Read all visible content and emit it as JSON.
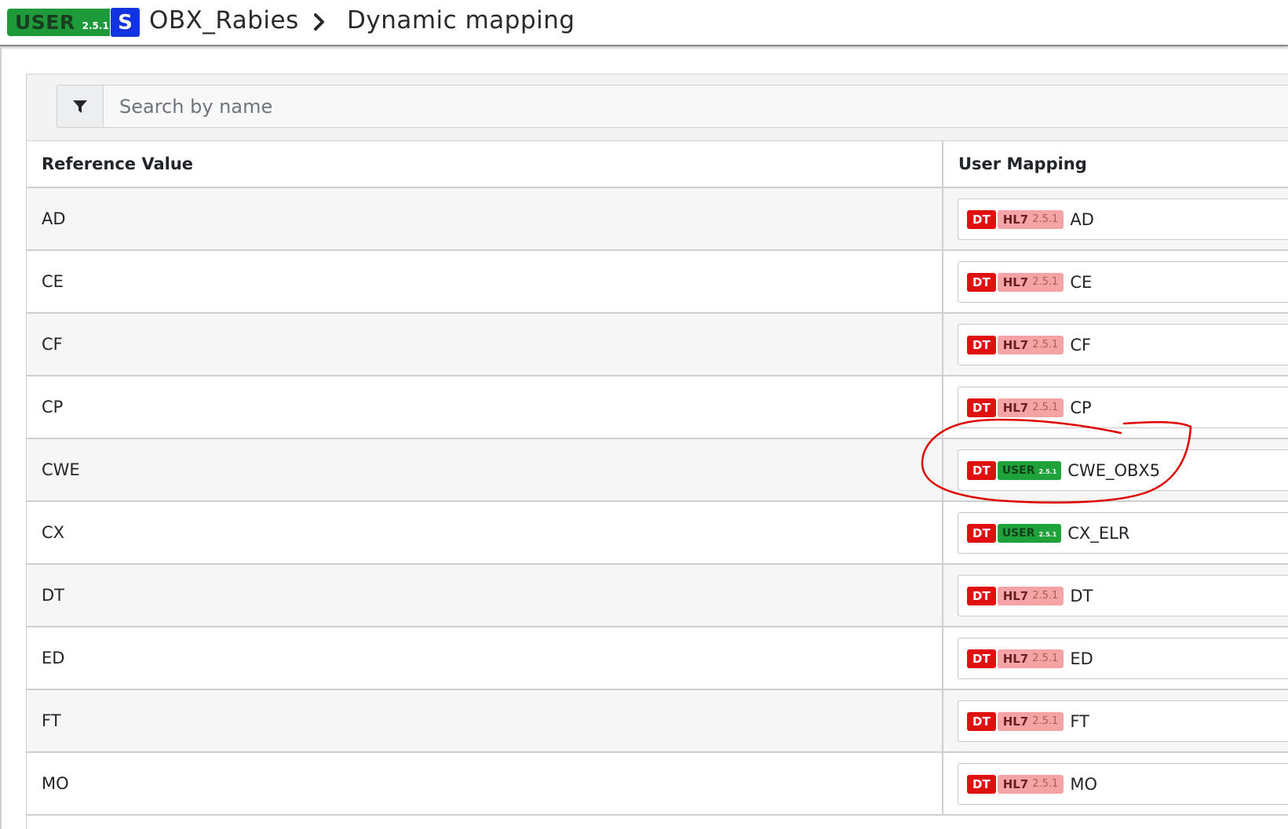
{
  "header": {
    "user_badge": {
      "label": "USER",
      "version": "2.5.1",
      "color": "#1f9a3a"
    },
    "s_badge": {
      "label": "S",
      "color": "#1234e0"
    },
    "breadcrumb_project": "OBX_Rabies",
    "breadcrumb_page": "Dynamic mapping"
  },
  "search": {
    "filter_icon": "filter-icon",
    "placeholder": "Search by name",
    "value": ""
  },
  "table": {
    "columns": [
      "Reference Value",
      "User Mapping"
    ],
    "rows": [
      {
        "reference": "AD",
        "mapping": {
          "type_badge": "DT",
          "source": "HL7",
          "version": "2.5.1",
          "name": "AD"
        }
      },
      {
        "reference": "CE",
        "mapping": {
          "type_badge": "DT",
          "source": "HL7",
          "version": "2.5.1",
          "name": "CE"
        }
      },
      {
        "reference": "CF",
        "mapping": {
          "type_badge": "DT",
          "source": "HL7",
          "version": "2.5.1",
          "name": "CF"
        }
      },
      {
        "reference": "CP",
        "mapping": {
          "type_badge": "DT",
          "source": "HL7",
          "version": "2.5.1",
          "name": "CP"
        }
      },
      {
        "reference": "CWE",
        "mapping": {
          "type_badge": "DT",
          "source": "USER",
          "version": "2.5.1",
          "name": "CWE_OBX5"
        }
      },
      {
        "reference": "CX",
        "mapping": {
          "type_badge": "DT",
          "source": "USER",
          "version": "2.5.1",
          "name": "CX_ELR"
        }
      },
      {
        "reference": "DT",
        "mapping": {
          "type_badge": "DT",
          "source": "HL7",
          "version": "2.5.1",
          "name": "DT"
        }
      },
      {
        "reference": "ED",
        "mapping": {
          "type_badge": "DT",
          "source": "HL7",
          "version": "2.5.1",
          "name": "ED"
        }
      },
      {
        "reference": "FT",
        "mapping": {
          "type_badge": "DT",
          "source": "HL7",
          "version": "2.5.1",
          "name": "FT"
        }
      },
      {
        "reference": "MO",
        "mapping": {
          "type_badge": "DT",
          "source": "HL7",
          "version": "2.5.1",
          "name": "MO"
        }
      }
    ]
  },
  "colors": {
    "dt_badge": "#e01010",
    "hl7_badge": "#f4a4a4",
    "user_badge": "#20a23b",
    "annotation": "#e00000"
  }
}
